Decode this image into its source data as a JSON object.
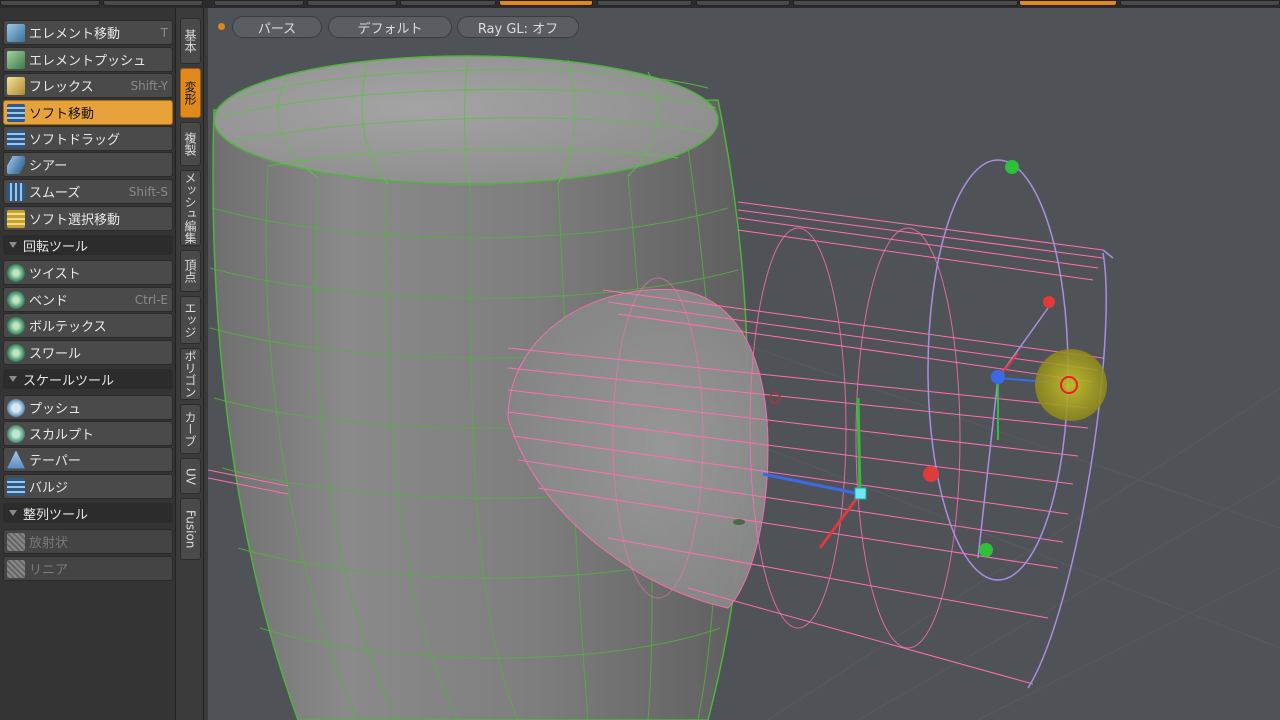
{
  "toolbar_top": {
    "segments": 8
  },
  "tools": {
    "items": [
      {
        "label": "エレメント移動",
        "shortcut": "T",
        "icon": "element-move-icon"
      },
      {
        "label": "エレメントプッシュ",
        "shortcut": "",
        "icon": "element-push-icon"
      },
      {
        "label": "フレックス",
        "shortcut": "Shift-Y",
        "icon": "flex-icon"
      },
      {
        "label": "ソフト移動",
        "shortcut": "",
        "icon": "soft-move-icon",
        "active": true
      },
      {
        "label": "ソフトドラッグ",
        "shortcut": "",
        "icon": "soft-drag-icon"
      },
      {
        "label": "シアー",
        "shortcut": "",
        "icon": "shear-icon"
      },
      {
        "label": "スムーズ",
        "shortcut": "Shift-S",
        "icon": "smooth-icon"
      },
      {
        "label": "ソフト選択移動",
        "shortcut": "",
        "icon": "soft-selection-move-icon"
      }
    ],
    "rotate_section": "回転ツール",
    "rotate_items": [
      {
        "label": "ツイスト",
        "shortcut": "",
        "icon": "twist-icon"
      },
      {
        "label": "ベンド",
        "shortcut": "Ctrl-E",
        "icon": "bend-icon"
      },
      {
        "label": "ボルテックス",
        "shortcut": "",
        "icon": "vortex-icon"
      },
      {
        "label": "スワール",
        "shortcut": "",
        "icon": "swirl-icon"
      }
    ],
    "scale_section": "スケールツール",
    "scale_items": [
      {
        "label": "プッシュ",
        "shortcut": "",
        "icon": "push-icon"
      },
      {
        "label": "スカルプト",
        "shortcut": "",
        "icon": "sculpt-icon"
      },
      {
        "label": "テーパー",
        "shortcut": "",
        "icon": "taper-icon"
      },
      {
        "label": "バルジ",
        "shortcut": "",
        "icon": "bulge-icon"
      }
    ],
    "align_section": "整列ツール",
    "align_items": [
      {
        "label": "放射状",
        "shortcut": "",
        "icon": "radial-icon",
        "disabled": true
      },
      {
        "label": "リニア",
        "shortcut": "",
        "icon": "linear-icon",
        "disabled": true
      }
    ]
  },
  "vtabs": [
    {
      "label": "基本"
    },
    {
      "label": "変形",
      "active": true
    },
    {
      "label": "複製"
    },
    {
      "label": "メッシュ編集"
    },
    {
      "label": "頂点"
    },
    {
      "label": "エッジ"
    },
    {
      "label": "ポリゴン"
    },
    {
      "label": "カーブ"
    },
    {
      "label": "UV"
    },
    {
      "label": "Fusion"
    }
  ],
  "viewport": {
    "projection": "パース",
    "shading": "デフォルト",
    "raygl": "Ray GL: オフ"
  },
  "colors": {
    "accent": "#e08a1e",
    "mesh_wire": "#5fbf4a",
    "selection_wire": "#ff6fb0",
    "falloff_wire": "#a98ee0",
    "viewport_bg": "#4f5358"
  }
}
